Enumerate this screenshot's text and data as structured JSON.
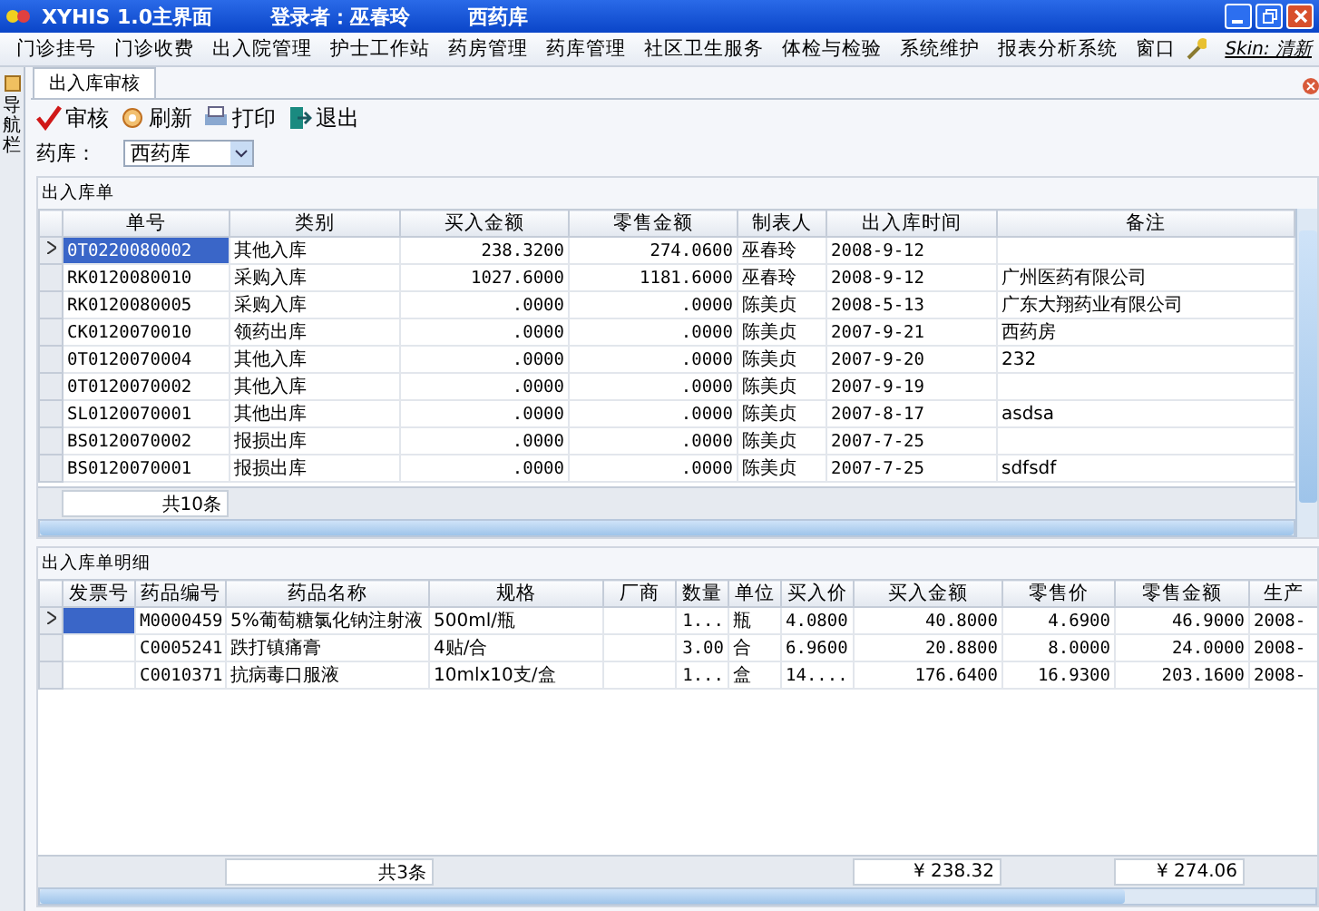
{
  "window": {
    "title": "XYHIS 1.0主界面",
    "user": "登录者：巫春玲",
    "store": "西药库"
  },
  "menu": [
    "门诊挂号",
    "门诊收费",
    "出入院管理",
    "护士工作站",
    "药房管理",
    "药库管理",
    "社区卫生服务",
    "体检与检验",
    "系统维护",
    "报表分析系统",
    "窗口"
  ],
  "skin": "Skin: 清新",
  "side_panel": {
    "label": "导航栏"
  },
  "tabs": [
    {
      "label": "出入库审核",
      "selected": true
    }
  ],
  "toolbar": [
    {
      "kind": "approve",
      "label": "审核"
    },
    {
      "kind": "refresh",
      "label": "刷新"
    },
    {
      "kind": "print",
      "label": "打印"
    },
    {
      "kind": "exit",
      "label": "退出"
    }
  ],
  "store_field": {
    "label": "药库：",
    "value": "西药库"
  },
  "orders": {
    "title": "出入库单",
    "columns": [
      "单号",
      "类别",
      "买入金额",
      "零售金额",
      "制表人",
      "出入库时间",
      "备注"
    ],
    "rows": [
      {
        "selected": true,
        "number": "0T0220080002",
        "type": "其他入库",
        "purchase": "238.3200",
        "retail": "274.0600",
        "creator": "巫春玲",
        "time": "2008-9-12"
      },
      {
        "selected": false,
        "number": "RK0120080010",
        "type": "采购入库",
        "purchase": "1027.6000",
        "retail": "1181.6000",
        "creator": "巫春玲",
        "time": "2008-9-12",
        "note": "广州医药有限公司"
      },
      {
        "selected": false,
        "number": "RK0120080005",
        "type": "采购入库",
        "purchase": ".0000",
        "retail": ".0000",
        "creator": "陈美贞",
        "time": "2008-5-13",
        "note": "广东大翔药业有限公司"
      },
      {
        "selected": false,
        "number": "CK0120070010",
        "type": "领药出库",
        "purchase": ".0000",
        "retail": ".0000",
        "creator": "陈美贞",
        "time": "2007-9-21",
        "note": "西药房"
      },
      {
        "selected": false,
        "number": "0T0120070004",
        "type": "其他入库",
        "purchase": ".0000",
        "retail": ".0000",
        "creator": "陈美贞",
        "time": "2007-9-20",
        "note": "232"
      },
      {
        "selected": false,
        "number": "0T0120070002",
        "type": "其他入库",
        "purchase": ".0000",
        "retail": ".0000",
        "creator": "陈美贞",
        "time": "2007-9-19"
      },
      {
        "selected": false,
        "number": "SL0120070001",
        "type": "其他出库",
        "purchase": ".0000",
        "retail": ".0000",
        "creator": "陈美贞",
        "time": "2007-8-17",
        "note": "asdsa"
      },
      {
        "selected": false,
        "number": "BS0120070002",
        "type": "报损出库",
        "purchase": ".0000",
        "retail": ".0000",
        "creator": "陈美贞",
        "time": "2007-7-25"
      },
      {
        "selected": false,
        "number": "BS0120070001",
        "type": "报损出库",
        "purchase": ".0000",
        "retail": ".0000",
        "creator": "陈美贞",
        "time": "2007-7-25",
        "note": "sdfsdf"
      }
    ],
    "footer": "共10条"
  },
  "details": {
    "title": "出入库单明细",
    "columns": [
      "发票号",
      "药品编号",
      "药品名称",
      "规格",
      "厂商",
      "数量",
      "单位",
      "买入价",
      "买入金额",
      "零售价",
      "零售金额",
      "生产"
    ],
    "rows": [
      {
        "selected": true,
        "code": "M0000459",
        "name": "5%葡萄糖氯化钠注射液",
        "spec": "500ml/瓶",
        "qty": "1...",
        "unit": "瓶",
        "buy_price": "4.0800",
        "buy_amount": "40.8000",
        "retail_price": "4.6900",
        "retail_amount": "46.9000",
        "production": "2008-"
      },
      {
        "selected": false,
        "code": "C0005241",
        "name": "跌打镇痛膏",
        "spec": "4贴/合",
        "qty": "3.00",
        "unit": "合",
        "buy_price": "6.9600",
        "buy_amount": "20.8800",
        "retail_price": "8.0000",
        "retail_amount": "24.0000",
        "production": "2008-"
      },
      {
        "selected": false,
        "code": "C0010371",
        "name": "抗病毒口服液",
        "spec": "10mlx10支/盒",
        "qty": "1...",
        "unit": "盒",
        "buy_price": "14....",
        "buy_amount": "176.6400",
        "retail_price": "16.9300",
        "retail_amount": "203.1600",
        "production": "2008-"
      }
    ],
    "footer": {
      "count": "共3条",
      "buy_total": "¥ 238.32",
      "retail_total": "¥ 274.06"
    }
  }
}
